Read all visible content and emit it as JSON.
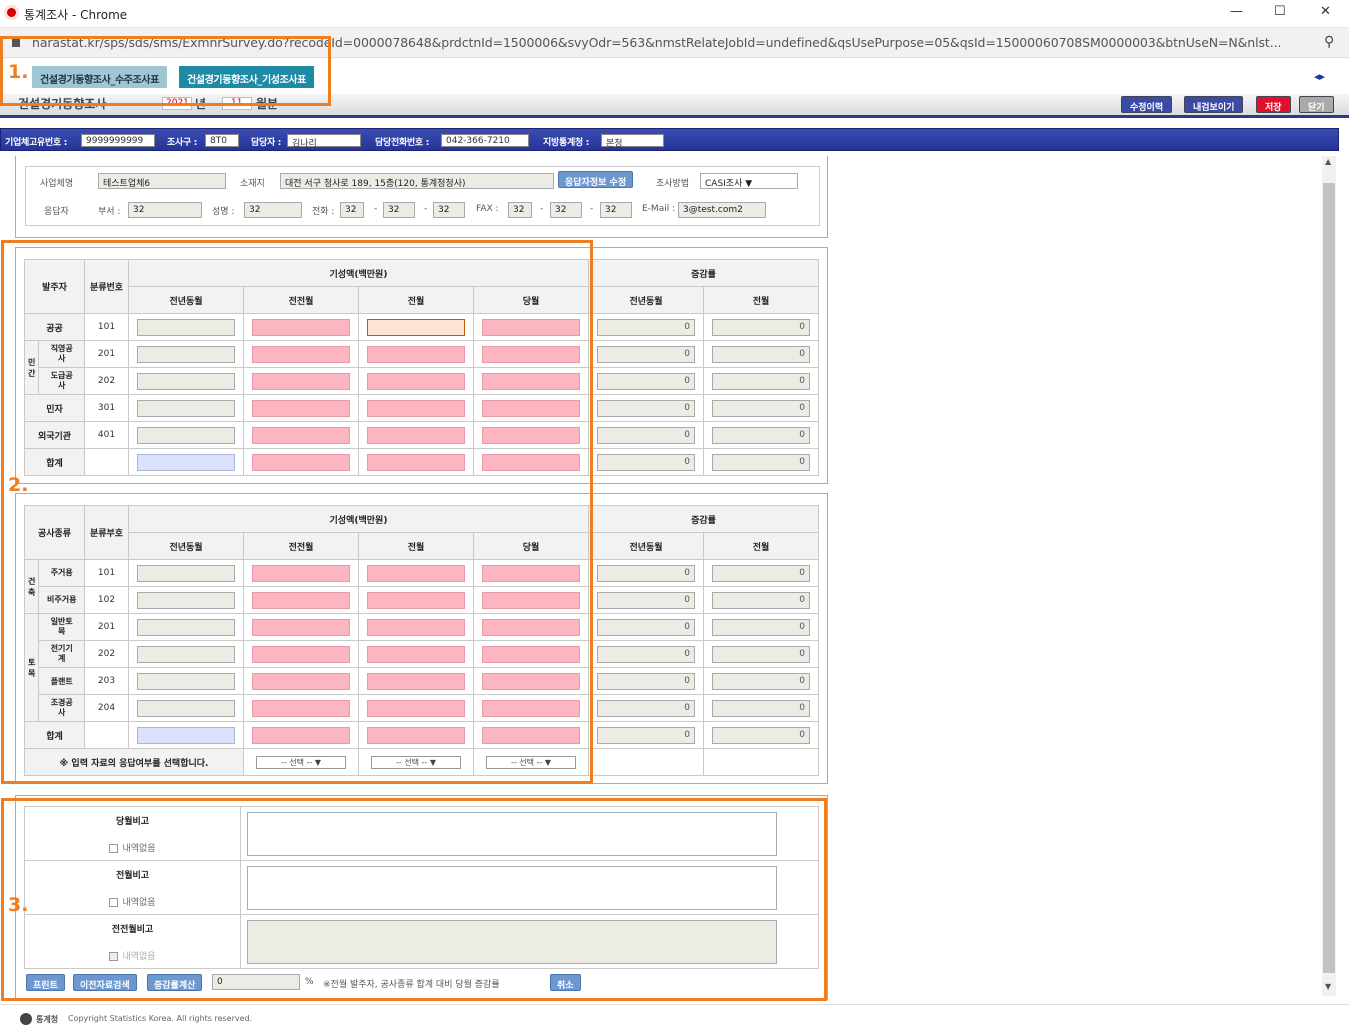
{
  "window": {
    "title": "통계조사 - Chrome",
    "min": "—",
    "max": "☐",
    "close": "✕"
  },
  "url": "narastat.kr/sps/sds/sms/ExmnrSurvey.do?recodeId=0000078648&prdctnId=1500006&svyOdr=563&nmstRelateJobId=undefined&qsUsePurpose=05&qsId=15000060708SM0000003&btnUseN=N&nlst...",
  "tabs": [
    "건설경기동향조사_수주조사표",
    "건설경기동향조사_기성조사표"
  ],
  "nav_arrows": "◂▸",
  "header": {
    "survey_name": "건설경기동향조사",
    "year": "2021",
    "year_unit": "년",
    "month": "11",
    "month_unit": "월분"
  },
  "buttons": {
    "history": "수정이력",
    "preview": "내검보이기",
    "save": "저장",
    "close": "닫기"
  },
  "info": {
    "corp_id_label": "기업체고유번호 :",
    "corp_id": "9999999999",
    "surveyor_label": "조사구 :",
    "surveyor": "8T0",
    "manager_label": "담당자 :",
    "manager": "김나리",
    "phone_label": "담당전화번호 :",
    "phone": "042-366-7210",
    "office_label": "지방통계청 :",
    "office": "본청"
  },
  "company": {
    "name_label": "사업체명",
    "name": "테스트업체6",
    "addr_label": "소재지",
    "addr": "대전 서구 청사로 189, 15층(120, 통계청청사)",
    "edit_btn": "응답자정보 수정",
    "method_label": "조사방법",
    "method": "CASI조사 ▼",
    "resp_label": "응답자",
    "dept_label": "부서 :",
    "dept": "32",
    "nm_label": "성명 :",
    "nm": "32",
    "tel_label": "전화 :",
    "tel": [
      "32",
      "32",
      "32"
    ],
    "fax_label": "FAX :",
    "fax": [
      "32",
      "32",
      "32"
    ],
    "email_label": "E-Mail :",
    "email": "3@test.com2",
    "dash": "-"
  },
  "table1": {
    "h_client": "발주자",
    "h_code": "분류번호",
    "h_amount": "기성액(백만원)",
    "h_change": "증감률",
    "sub": [
      "전년동월",
      "전전월",
      "전월",
      "당월",
      "전년동월",
      "전월"
    ],
    "rows": [
      {
        "name": "공공",
        "code": "101"
      },
      {
        "group": "민간",
        "name": "직영공사",
        "code": "201"
      },
      {
        "name": "도급공사",
        "code": "202"
      },
      {
        "name": "민자",
        "code": "301"
      },
      {
        "name": "외국기관",
        "code": "401"
      },
      {
        "name": "합계",
        "code": ""
      }
    ],
    "zero": "0"
  },
  "table2": {
    "h_type": "공사종류",
    "h_code": "분류부호",
    "h_amount": "기성액(백만원)",
    "h_change": "증감률",
    "sub": [
      "전년동월",
      "전전월",
      "전월",
      "당월",
      "전년동월",
      "전월"
    ],
    "g1": "건축",
    "g2": "토목",
    "rows": [
      {
        "name": "주거용",
        "code": "101"
      },
      {
        "name": "비주거용",
        "code": "102"
      },
      {
        "name": "일반토목",
        "code": "201"
      },
      {
        "name": "전기기계",
        "code": "202"
      },
      {
        "name": "플랜트",
        "code": "203"
      },
      {
        "name": "조경공사",
        "code": "204"
      },
      {
        "name": "합계",
        "code": ""
      }
    ],
    "note": "※ 입력 자료의 응답여부를 선택합니다.",
    "select": "-- 선택 -- ▼",
    "zero": "0"
  },
  "remarks": {
    "cur": "당월비고",
    "prev": "전월비고",
    "prev2": "전전월비고",
    "none": "내역없음"
  },
  "bottom": {
    "print": "프린트",
    "prev_data": "이전자료검색",
    "calc": "증감률계산",
    "pct_value": "0",
    "pct": "%",
    "desc": "※전월 발주자, 공사종류 합계 대비 당월 증감률",
    "cancel": "취소"
  },
  "labels": {
    "l1": "1.",
    "l2": "2.",
    "l3": "3."
  },
  "footer": "Copyright Statistics Korea. All rights reserved.",
  "footer_logo": "통계청",
  "colors": {
    "accent": "#2d3a8c",
    "highlight": "#f07e21",
    "pink": "#fcb6c2"
  }
}
